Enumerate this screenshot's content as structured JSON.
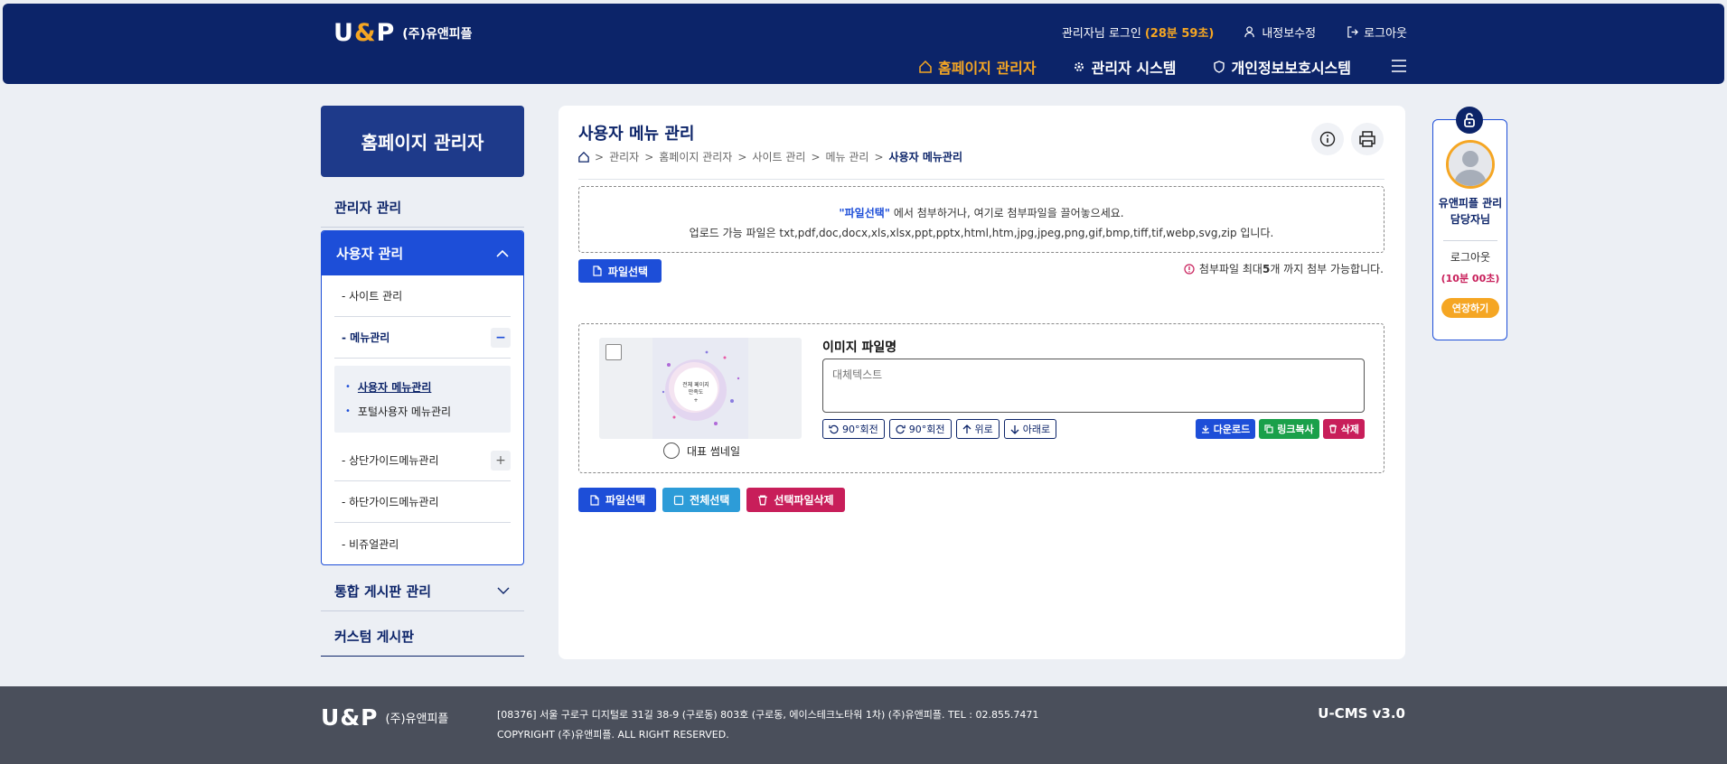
{
  "header": {
    "logo_mark_left": "U",
    "logo_mark_amp": "&",
    "logo_mark_right": "P",
    "company": "(주)유앤피플",
    "login_text": "관리자님 로그인",
    "timer": "(28분 59초)",
    "my_info": "내정보수정",
    "logout": "로그아웃",
    "nav": [
      "홈페이지 관리자",
      "관리자 시스템",
      "개인정보보호시스템"
    ]
  },
  "sidebar": {
    "title": "홈페이지 관리자",
    "admin_mgmt": "관리자 관리",
    "user_mgmt": "사용자 관리",
    "sub": {
      "site": "- 사이트 관리",
      "menu": "- 메뉴관리",
      "menu_children": [
        "사용자 메뉴관리",
        "포털사용자 메뉴관리"
      ],
      "top_guide": "- 상단가이드메뉴관리",
      "bottom_guide": "- 하단가이드메뉴관리",
      "visual": "- 비쥬얼관리"
    },
    "board_mgmt": "통합 게시판 관리",
    "custom_board": "커스텀 게시판"
  },
  "main": {
    "title": "사용자 메뉴 관리",
    "breadcrumb": [
      "관리자",
      "홈페이지 관리자",
      "사이트 관리",
      "메뉴 관리",
      "사용자 메뉴관리"
    ],
    "dropzone_hl": "\"파일선택\"",
    "dropzone_line1_rest": " 에서 첨부하거나, 여기로 첨부파일을 끌어놓으세요.",
    "dropzone_line2": "업로드 가능 파일은 txt,pdf,doc,docx,xls,xlsx,ppt,pptx,html,htm,jpg,jpeg,png,gif,bmp,tiff,tif,webp,svg,zip 입니다.",
    "file_select": "파일선택",
    "limit_pre": "첨부파일 최대 ",
    "limit_num": "5",
    "limit_post": "개 까지 첨부 가능합니다.",
    "thumb_text_1": "전체 페이지",
    "thumb_text_2": "만족도",
    "thumb_text_3": "+",
    "rep_thumb": "대표 썸네일",
    "file_name_label": "이미지 파일명",
    "alt_placeholder": "대체텍스트",
    "tools": [
      "90°회전",
      "90°회전",
      "위로",
      "아래로"
    ],
    "actions": [
      "다운로드",
      "링크복사",
      "삭제"
    ],
    "bottom": [
      "파일선택",
      "전체선택",
      "선택파일삭제"
    ]
  },
  "login_widget": {
    "name": "유앤피플 관리담당자님",
    "logout": "로그아웃",
    "timer": "(10분 00초)",
    "extend": "연장하기"
  },
  "footer": {
    "company": "(주)유앤피플",
    "address": "[08376] 서울 구로구 디지털로 31길 38-9 (구로동) 803호 (구로동, 에이스테크노타워 1차) (주)유앤피플. TEL : 02.855.7471",
    "copyright": "COPYRIGHT (주)유앤피플. ALL RIGHT RESERVED.",
    "version": "U-CMS v3.0"
  },
  "colors": {
    "navy": "#0c2469",
    "accent": "#f5a623",
    "primary": "#1d4ed8",
    "danger": "#c81e5a",
    "success": "#1aa04a"
  }
}
